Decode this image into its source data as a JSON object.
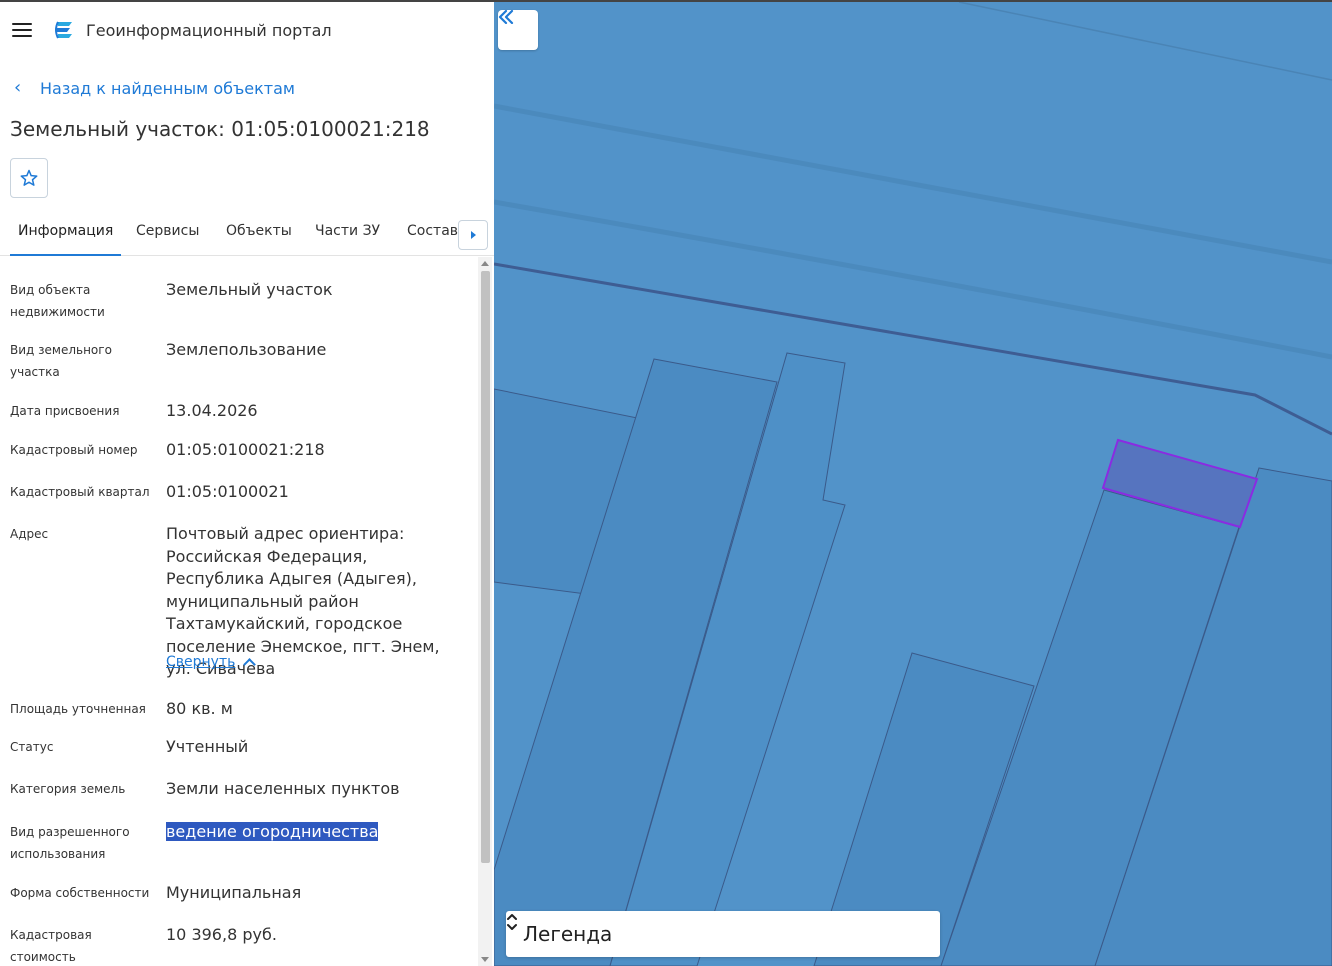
{
  "header": {
    "app_title": "Геоинформационный портал",
    "icons": {
      "menu": "hamburger-menu-icon",
      "logo": "portal-logo-icon"
    }
  },
  "nav": {
    "back_label": "Назад к найденным объектам"
  },
  "object": {
    "title": "Земельный участок: 01:05:0100021:218"
  },
  "tabs": [
    {
      "label": "Информация",
      "active": true
    },
    {
      "label": "Сервисы",
      "active": false
    },
    {
      "label": "Объекты",
      "active": false
    },
    {
      "label": "Части ЗУ",
      "active": false
    },
    {
      "label": "Состав",
      "active": false
    }
  ],
  "properties": [
    {
      "label": "Вид объекта недвижимости",
      "value": "Земельный участок"
    },
    {
      "label": "Вид земельного участка",
      "value": "Землепользование"
    },
    {
      "label": "Дата присвоения",
      "value": "13.04.2026"
    },
    {
      "label": "Кадастровый номер",
      "value": "01:05:0100021:218"
    },
    {
      "label": "Кадастровый квартал",
      "value": "01:05:0100021"
    },
    {
      "label": "Адрес",
      "value": "Почтовый адрес ориентира: Российская Федерация, Республика Адыгея (Адыгея), муниципальный район Тахтамукайский, городское поселение Энемское, пгт. Энем, ул. Сивачева",
      "collapse_label": "Свернуть"
    },
    {
      "label": "Площадь уточненная",
      "value": "80 кв. м"
    },
    {
      "label": "Статус",
      "value": "Учтенный"
    },
    {
      "label": "Категория земель",
      "value": "Земли населенных пунктов"
    },
    {
      "label": "Вид разрешенного использования",
      "value": "ведение огородничества",
      "selected": true
    },
    {
      "label": "Форма собственности",
      "value": "Муниципальная"
    },
    {
      "label": "Кадастровая стоимость",
      "value": "10 396,8 руб."
    }
  ],
  "map": {
    "legend_label": "Легенда",
    "colors": {
      "background": "#5293c9",
      "parcel_fill": "#4b8bc2",
      "parcel_stroke": "#3a5a8a",
      "boundary_line": "#3e5d93",
      "selected_fill": "#5674bf",
      "selected_stroke": "#8a2be2"
    }
  },
  "colors": {
    "accent": "#1f7ad6",
    "selection": "#2e59c0"
  }
}
